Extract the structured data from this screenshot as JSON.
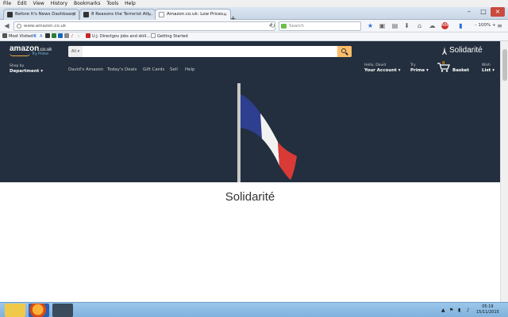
{
  "menu": [
    "File",
    "Edit",
    "View",
    "History",
    "Bookmarks",
    "Tools",
    "Help"
  ],
  "tabs": [
    {
      "label": "Before It's News Dashboard",
      "active": false
    },
    {
      "label": "8 Reasons the Terrorist Att...",
      "active": false
    },
    {
      "label": "Amazon.co.uk: Low Prices...",
      "active": true
    }
  ],
  "nav": {
    "url": "www.amazon.co.uk",
    "search_placeholder": "Search",
    "zoom": "100%"
  },
  "bookmarks": {
    "most_visited": "Most Visited",
    "jobs": "U.J. Directgov jobs and skill...",
    "getting_started": "Getting Started"
  },
  "amazon": {
    "logo": "amazon",
    "logo_tld": ".co.uk",
    "try_prime": "Try Prime",
    "search_category": "All",
    "solidarity_header": "Solidarité",
    "shop_by": "Shop by",
    "department": "Department",
    "links": [
      "David's Amazon",
      "Today's Deals",
      "Gift Cards",
      "Sell",
      "Help"
    ],
    "hello": "Hello, David",
    "your_account": "Your Account",
    "try": "Try",
    "prime": "Prime",
    "cart_count": "0",
    "basket": "Basket",
    "wish": "Wish",
    "list": "List"
  },
  "hero": {
    "title": "Solidarité",
    "flag_colors": [
      "#2e3f8f",
      "#f2f2f2",
      "#d93a36"
    ]
  },
  "taskbar": {
    "time": "05:19",
    "date": "15/11/2015"
  }
}
